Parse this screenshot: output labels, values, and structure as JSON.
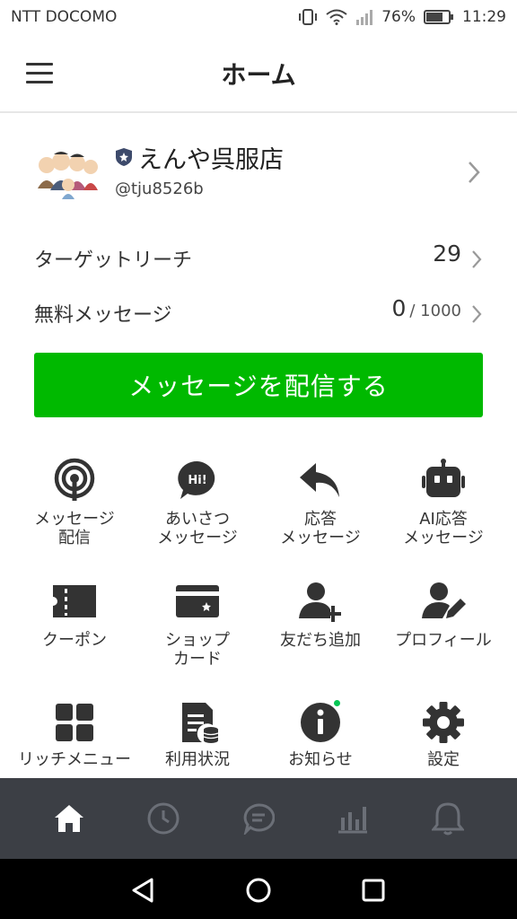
{
  "status_bar": {
    "carrier": "NTT DOCOMO",
    "battery": "76%",
    "time": "11:29"
  },
  "header": {
    "title": "ホーム"
  },
  "account": {
    "name": "えんや呉服店",
    "id": "@tju8526b"
  },
  "stats": {
    "target_reach": {
      "label": "ターゲットリーチ",
      "value": "29"
    },
    "free_messages": {
      "label": "無料メッセージ",
      "value": "0",
      "limit": "/ 1000"
    }
  },
  "primary_button": "メッセージを配信する",
  "grid": [
    {
      "label": "メッセージ\n配信",
      "icon": "broadcast-icon"
    },
    {
      "label": "あいさつ\nメッセージ",
      "icon": "hi-bubble-icon",
      "icon_text": "Hi!"
    },
    {
      "label": "応答\nメッセージ",
      "icon": "reply-arrow-icon"
    },
    {
      "label": "AI応答\nメッセージ",
      "icon": "robot-icon"
    },
    {
      "label": "クーポン",
      "icon": "coupon-icon"
    },
    {
      "label": "ショップ\nカード",
      "icon": "shop-card-icon"
    },
    {
      "label": "友だち追加",
      "icon": "add-friend-icon"
    },
    {
      "label": "プロフィール",
      "icon": "profile-edit-icon"
    },
    {
      "label": "リッチメニュー",
      "icon": "rich-menu-icon"
    },
    {
      "label": "利用状況",
      "icon": "usage-icon"
    },
    {
      "label": "お知らせ",
      "icon": "info-icon"
    },
    {
      "label": "設定",
      "icon": "gear-icon"
    }
  ],
  "tabs": [
    {
      "name": "home",
      "icon": "home-icon",
      "active": true
    },
    {
      "name": "history",
      "icon": "clock-icon",
      "active": false
    },
    {
      "name": "chat",
      "icon": "chat-icon",
      "active": false
    },
    {
      "name": "stats",
      "icon": "bar-chart-icon",
      "active": false
    },
    {
      "name": "notifications",
      "icon": "bell-icon",
      "active": false
    }
  ],
  "colors": {
    "primary": "#00b900",
    "tabbar_bg": "#3c3f45",
    "notification_dot": "#06c755"
  }
}
